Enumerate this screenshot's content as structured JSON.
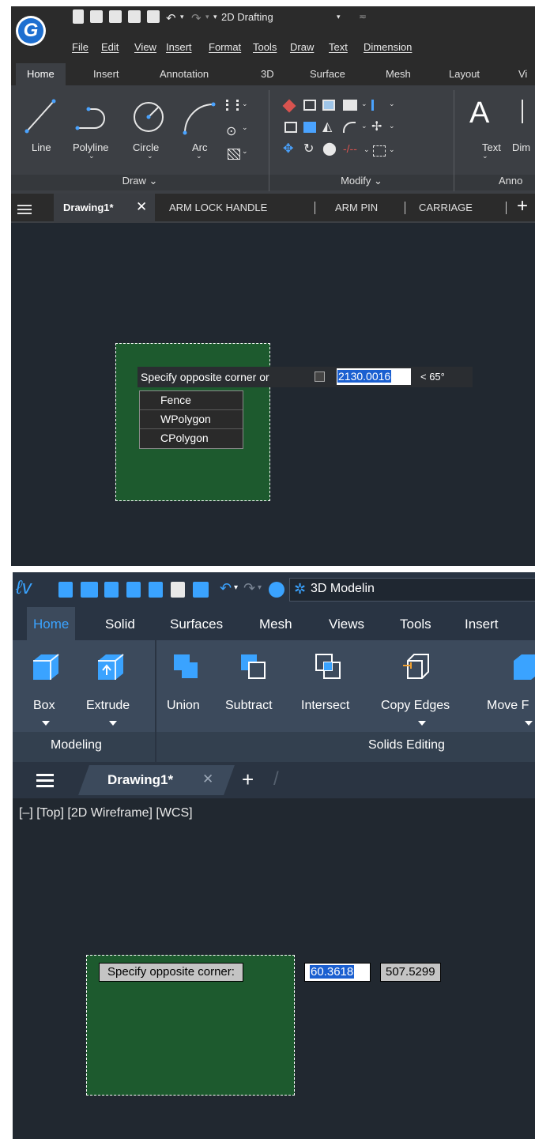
{
  "panel1": {
    "quickaccess": {
      "workspace": "2D Drafting",
      "logo_letter": "G"
    },
    "menus": [
      "File",
      "Edit",
      "View",
      "Insert",
      "Format",
      "Tools",
      "Draw",
      "Text",
      "Dimension"
    ],
    "ribbon_tabs": [
      "Home",
      "Insert",
      "Annotation",
      "3D",
      "Surface",
      "Mesh",
      "Layout",
      "Vi"
    ],
    "draw_tools": [
      "Line",
      "Polyline",
      "Circle",
      "Arc"
    ],
    "annotate_tools": [
      "Text",
      "Dim"
    ],
    "groups": {
      "draw": "Draw",
      "modify": "Modify",
      "annotation": "Anno"
    },
    "doc_tabs": [
      "Drawing1*",
      "ARM LOCK HANDLE",
      "ARM PIN",
      "CARRIAGE"
    ],
    "prompt": {
      "text": "Specify opposite corner or",
      "value": "2130.0016",
      "angle": "< 65°"
    },
    "options": [
      "Fence",
      "WPolygon",
      "CPolygon"
    ]
  },
  "panel2": {
    "quickaccess": {
      "workspace": "3D Modelin"
    },
    "ribbon_tabs": [
      "Home",
      "Solid",
      "Surfaces",
      "Mesh",
      "Views",
      "Tools",
      "Insert"
    ],
    "tools": [
      "Box",
      "Extrude",
      "Union",
      "Subtract",
      "Intersect",
      "Copy Edges",
      "Move F"
    ],
    "groups": {
      "modeling": "Modeling",
      "solids_editing": "Solids Editing"
    },
    "doc_tab": "Drawing1*",
    "viewport_label": "[–] [Top] [2D Wireframe] [WCS]",
    "prompt": {
      "text": "Specify opposite corner:",
      "x_value": "60.3618",
      "y_value": "507.5299"
    }
  },
  "colors": {
    "canvas": "#212830",
    "selection_fill": "#1d5a2e",
    "highlight": "#1a5fd0",
    "bricscad_ribbon": "#3c4a5c",
    "bricscad_active_tab": "#3aa3ff"
  }
}
